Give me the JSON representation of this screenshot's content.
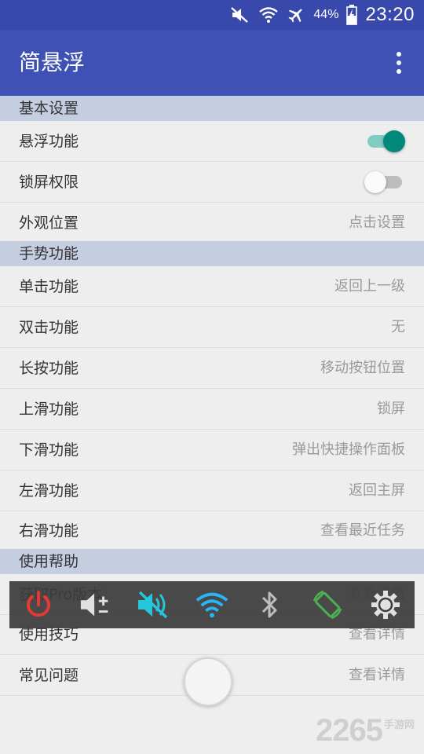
{
  "status_bar": {
    "icons": [
      "mute-icon",
      "wifi-icon",
      "airplane-icon",
      "battery-charging-icon"
    ],
    "battery": "44%",
    "time": "23:20",
    "color": "#3949ab"
  },
  "app_bar": {
    "title": "简悬浮",
    "menu_icon": "more-vert-icon",
    "color": "#3f51b5"
  },
  "sections": {
    "basic": {
      "header": "基本设置",
      "rows": [
        {
          "label": "悬浮功能",
          "switch": "on"
        },
        {
          "label": "锁屏权限",
          "switch": "off"
        },
        {
          "label": "外观位置",
          "value": "点击设置"
        }
      ]
    },
    "gesture": {
      "header": "手势功能",
      "rows": [
        {
          "label": "单击功能",
          "value": "返回上一级"
        },
        {
          "label": "双击功能",
          "value": "无"
        },
        {
          "label": "长按功能",
          "value": "移动按钮位置"
        },
        {
          "label": "上滑功能",
          "value": "锁屏"
        },
        {
          "label": "下滑功能",
          "value": "弹出快捷操作面板"
        },
        {
          "label": "左滑功能",
          "value": "返回主屏"
        },
        {
          "label": "右滑功能",
          "value": "查看最近任务"
        }
      ]
    },
    "help": {
      "header": "使用帮助",
      "rows": [
        {
          "label": "获取Pro版本",
          "value": "查看详情"
        },
        {
          "label": "使用技巧",
          "value": "查看详情"
        },
        {
          "label": "常见问题",
          "value": "查看详情"
        }
      ]
    }
  },
  "quick_panel": {
    "icons": [
      "power-icon",
      "volume-adjust-icon",
      "volume-mute-icon",
      "wifi-toggle-icon",
      "bluetooth-icon",
      "auto-rotate-icon",
      "settings-gear-icon"
    ],
    "colors": {
      "power": "#e53935",
      "volume": "#e0e0e0",
      "mute": "#26c6da",
      "wifi": "#29b6f6",
      "bluetooth": "#bdbdbd",
      "rotate": "#4caf50",
      "gear": "#e0e0e0"
    }
  },
  "float_ball": {
    "icon": "floating-button"
  },
  "watermark": {
    "number": "2265",
    "site": "手游网"
  },
  "accent_color": "#00897b"
}
